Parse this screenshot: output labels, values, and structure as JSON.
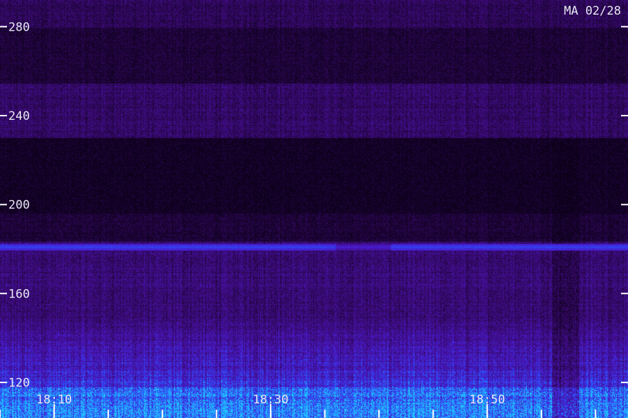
{
  "stamp": "MA 02/28",
  "chart_data": {
    "type": "heatmap",
    "title": "",
    "xlabel": "",
    "ylabel": "",
    "y_ticks": [
      120,
      160,
      200,
      240,
      280
    ],
    "y_tick_labels": [
      "120",
      "160",
      "200",
      "240",
      "280"
    ],
    "ylim": [
      104,
      292
    ],
    "x_major_ticks": [
      "18:10",
      "18:30",
      "18:50"
    ],
    "x_minor_tick_step_minutes": 5,
    "xlim": [
      "18:05",
      "19:03"
    ],
    "colormap": [
      "#0a0014",
      "#3a0a70",
      "#4a18c8",
      "#2a50ff",
      "#20d0ff"
    ],
    "features": [
      {
        "kind": "band",
        "y": 181,
        "intensity": 0.85,
        "label": ""
      },
      {
        "kind": "dark_band",
        "y_range": [
          196,
          230
        ],
        "intensity": 0.05
      },
      {
        "kind": "noise_floor",
        "y_range": [
          104,
          150
        ],
        "intensity": 0.6
      }
    ]
  }
}
